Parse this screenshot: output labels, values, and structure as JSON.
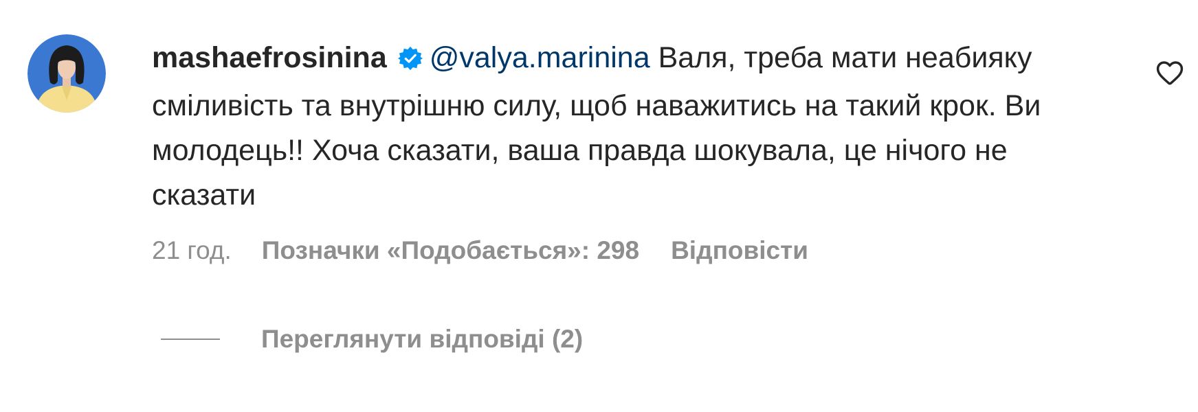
{
  "comment": {
    "username": "mashaefrosinina",
    "verified": true,
    "mention": "@valya.marinina",
    "text": " Валя, треба мати неабияку сміливість та внутрішню силу, щоб наважитись на такий крок. Ви молодець!! Хоча сказати, ваша правда шокувала, це нічого не сказати"
  },
  "meta": {
    "time": "21 год.",
    "likes": "Позначки «Подобається»: 298",
    "reply": "Відповісти"
  },
  "replies": {
    "label": "Переглянути відповіді (2)"
  },
  "icons": {
    "avatar": "user-avatar",
    "verified": "verified-badge-icon",
    "like": "heart-icon"
  },
  "colors": {
    "verified_badge": "#0095f6",
    "mention": "#00376b",
    "secondary_text": "#8e8e8e",
    "primary_text": "#262626"
  }
}
